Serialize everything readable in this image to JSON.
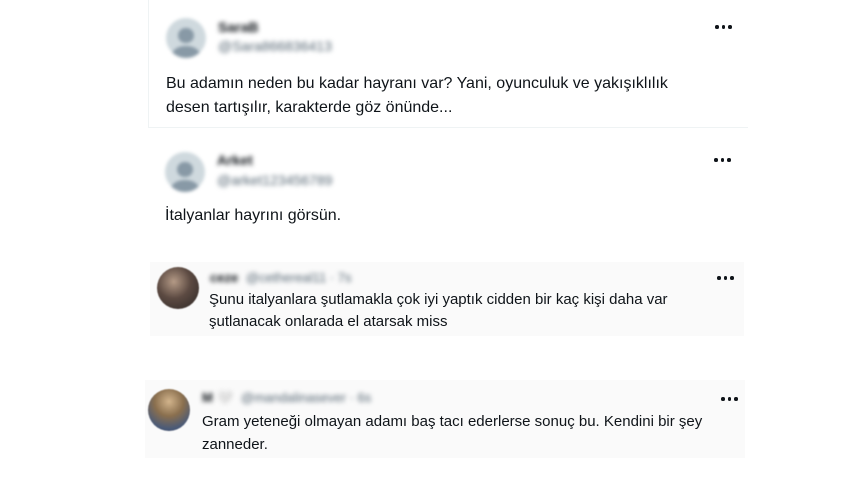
{
  "replies": [
    {
      "display_name": "SaraB",
      "handle": "@Sara866836413",
      "text_line1": "Bu adamın neden bu kadar hayranı var?  Yani, oyunculuk ve yakışıklılık",
      "text_line2": "desen tartışılır, karakterde göz önünde...",
      "avatar_icon": "default-avatar-icon",
      "more_icon": "more-options-icon"
    },
    {
      "display_name": "Arket",
      "handle": "@arket123456789",
      "text_line1": "İtalyanlar hayrını görsün.",
      "avatar_icon": "default-avatar-icon",
      "more_icon": "more-options-icon"
    },
    {
      "display_name": "ceze",
      "handle_time": "@cethereal11 · 7s",
      "text_line1": "Şunu italyanlara şutlamakla çok iyi yaptık cidden bir kaç kişi daha var",
      "text_line2": "şutlanacak onlarada el atarsak miss",
      "avatar_icon": "profile-photo-icon",
      "more_icon": "more-options-icon"
    },
    {
      "display_name": "M 🤍",
      "handle_time": "@mandalinasever · 6s",
      "text_line1": "Gram yeteneği olmayan adamı baş tacı ederlerse sonuç bu. Kendini bir şey",
      "text_line2": "zanneder.",
      "avatar_icon": "profile-photo-icon",
      "more_icon": "more-options-icon"
    }
  ],
  "colors": {
    "text_primary": "#0f1419",
    "text_secondary": "#536471",
    "divider": "#eff3f4"
  }
}
